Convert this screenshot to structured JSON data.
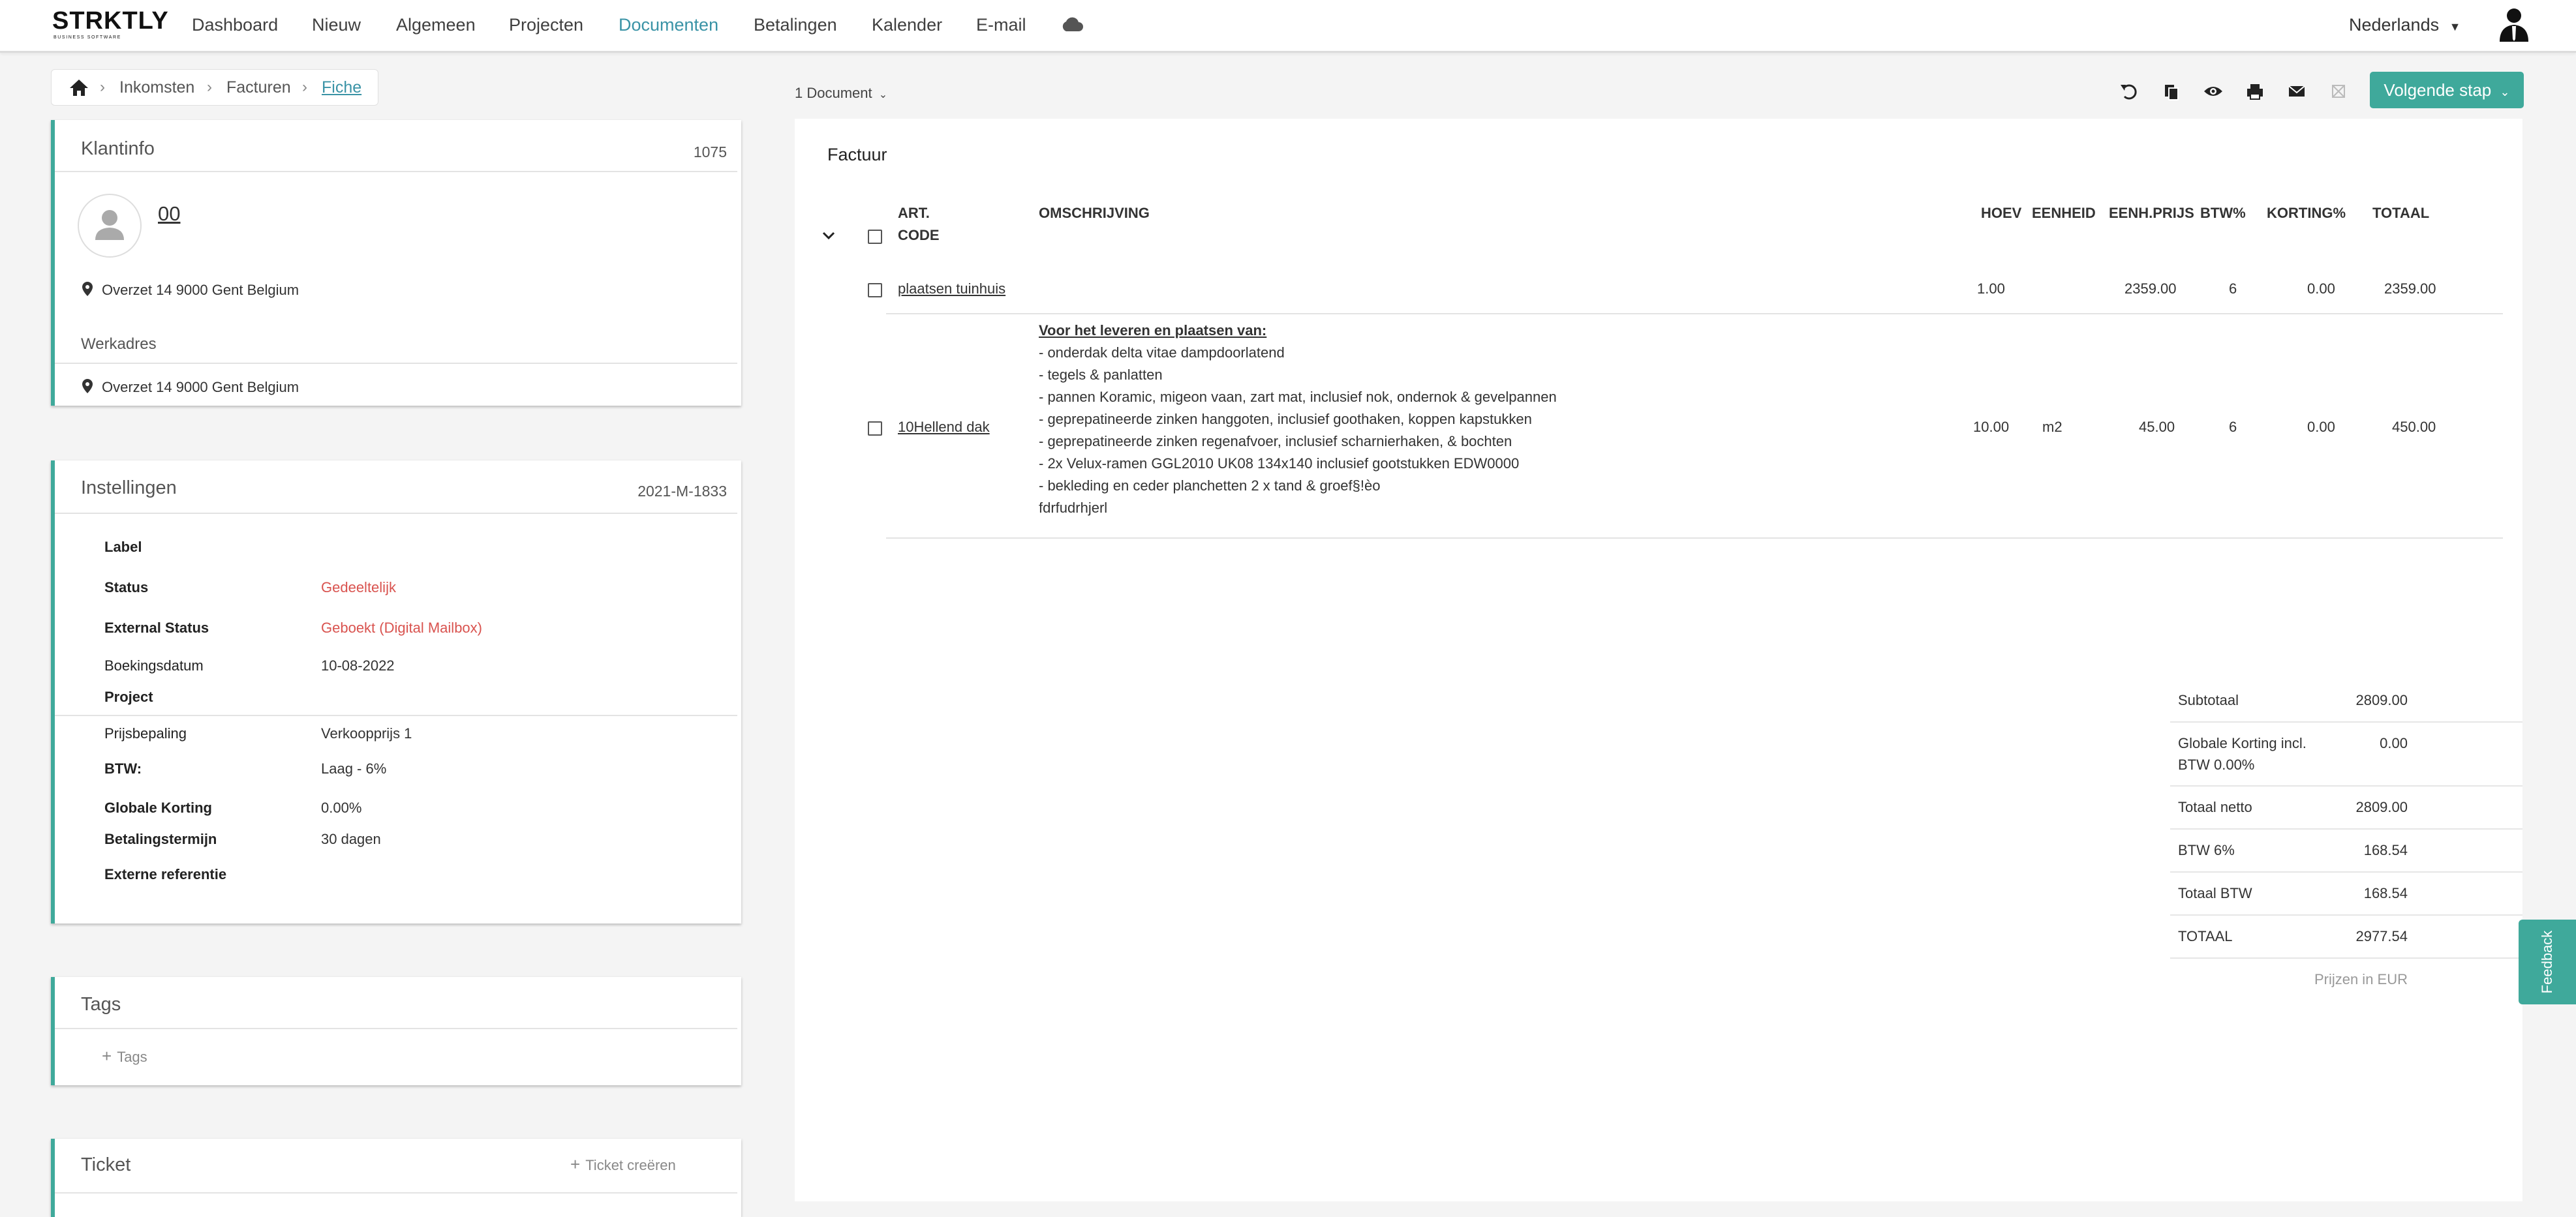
{
  "brand": {
    "name": "STRKTLY",
    "tagline": "BUSINESS SOFTWARE"
  },
  "nav": {
    "items": [
      "Dashboard",
      "Nieuw",
      "Algemeen",
      "Projecten",
      "Documenten",
      "Betalingen",
      "Kalender",
      "E-mail"
    ],
    "active": "Documenten",
    "language": "Nederlands"
  },
  "breadcrumb": {
    "items": [
      "Inkomsten",
      "Facturen",
      "Fiche"
    ]
  },
  "klantinfo": {
    "title": "Klantinfo",
    "number": "1075",
    "customer_name": "00",
    "address": "Overzet 14 9000 Gent Belgium",
    "werkadres_title": "Werkadres",
    "werkadres": "Overzet 14 9000 Gent Belgium"
  },
  "instellingen": {
    "title": "Instellingen",
    "number": "2021-M-1833",
    "rows": [
      {
        "label": "Label",
        "value": ""
      },
      {
        "label": "Status",
        "value": "Gedeeltelijk"
      },
      {
        "label": "External Status",
        "value": "Geboekt (Digital Mailbox)"
      },
      {
        "label": "Boekingsdatum",
        "value": "10-08-2022"
      },
      {
        "label": "Project",
        "value": ""
      },
      {
        "label": "Prijsbepaling",
        "value": "Verkoopprijs 1"
      },
      {
        "label": "BTW:",
        "value": "Laag - 6%"
      },
      {
        "label": "Globale Korting",
        "value": "0.00%"
      },
      {
        "label": "Betalingstermijn",
        "value": "30 dagen"
      },
      {
        "label": "Externe referentie",
        "value": ""
      }
    ]
  },
  "tags": {
    "title": "Tags",
    "add_label": "Tags"
  },
  "ticket": {
    "title": "Ticket",
    "create_label": "Ticket creëren"
  },
  "toolbar": {
    "doc_select": "1 Document",
    "next_step": "Volgende stap"
  },
  "invoice": {
    "title": "Factuur",
    "columns": {
      "code_line1": "ART.",
      "code_line2": "CODE",
      "description": "OMSCHRIJVING",
      "qty": "HOEV",
      "unit": "EENHEID",
      "unit_price": "EENH.PRIJS",
      "vat": "BTW%",
      "discount": "KORTING%",
      "total": "TOTAAL"
    },
    "lines": [
      {
        "code": "plaatsen tuinhuis",
        "description": [],
        "qty": "1.00",
        "unit": "",
        "unit_price": "2359.00",
        "vat": "6",
        "discount": "0.00",
        "total": "2359.00"
      },
      {
        "code": "10Hellend dak",
        "description": [
          "Voor het leveren en plaatsen van:",
          "- onderdak delta vitae dampdoorlatend",
          "- tegels & panlatten",
          "- pannen Koramic, migeon vaan, zart mat, inclusief nok, ondernok & gevelpannen",
          "- geprepatineerde zinken hanggoten, inclusief goothaken, koppen kapstukken",
          "- geprepatineerde zinken regenafvoer, inclusief scharnierhaken, & bochten",
          "- 2x Velux-ramen GGL2010 UK08 134x140 inclusief gootstukken EDW0000",
          "- bekleding en ceder planchetten 2 x tand & groef§!èo",
          "fdrfudrhjerl"
        ],
        "qty": "10.00",
        "unit": "m2",
        "unit_price": "45.00",
        "vat": "6",
        "discount": "0.00",
        "total": "450.00"
      }
    ],
    "totals": {
      "subtotaal_label": "Subtotaal",
      "subtotaal": "2809.00",
      "korting_label_1": "Globale Korting incl.",
      "korting_label_2": "BTW 0.00%",
      "korting": "0.00",
      "netto_label": "Totaal netto",
      "netto": "2809.00",
      "btw6_label": "BTW 6%",
      "btw6": "168.54",
      "totaal_btw_label": "Totaal BTW",
      "totaal_btw": "168.54",
      "totaal_label": "TOTAAL",
      "totaal": "2977.54",
      "currency_note": "Prijzen in EUR"
    }
  },
  "feedback": {
    "label": "Feedback"
  },
  "colors": {
    "accent": "#3fa99b",
    "link_active": "#3a93a6",
    "status_red": "#d9534f"
  }
}
